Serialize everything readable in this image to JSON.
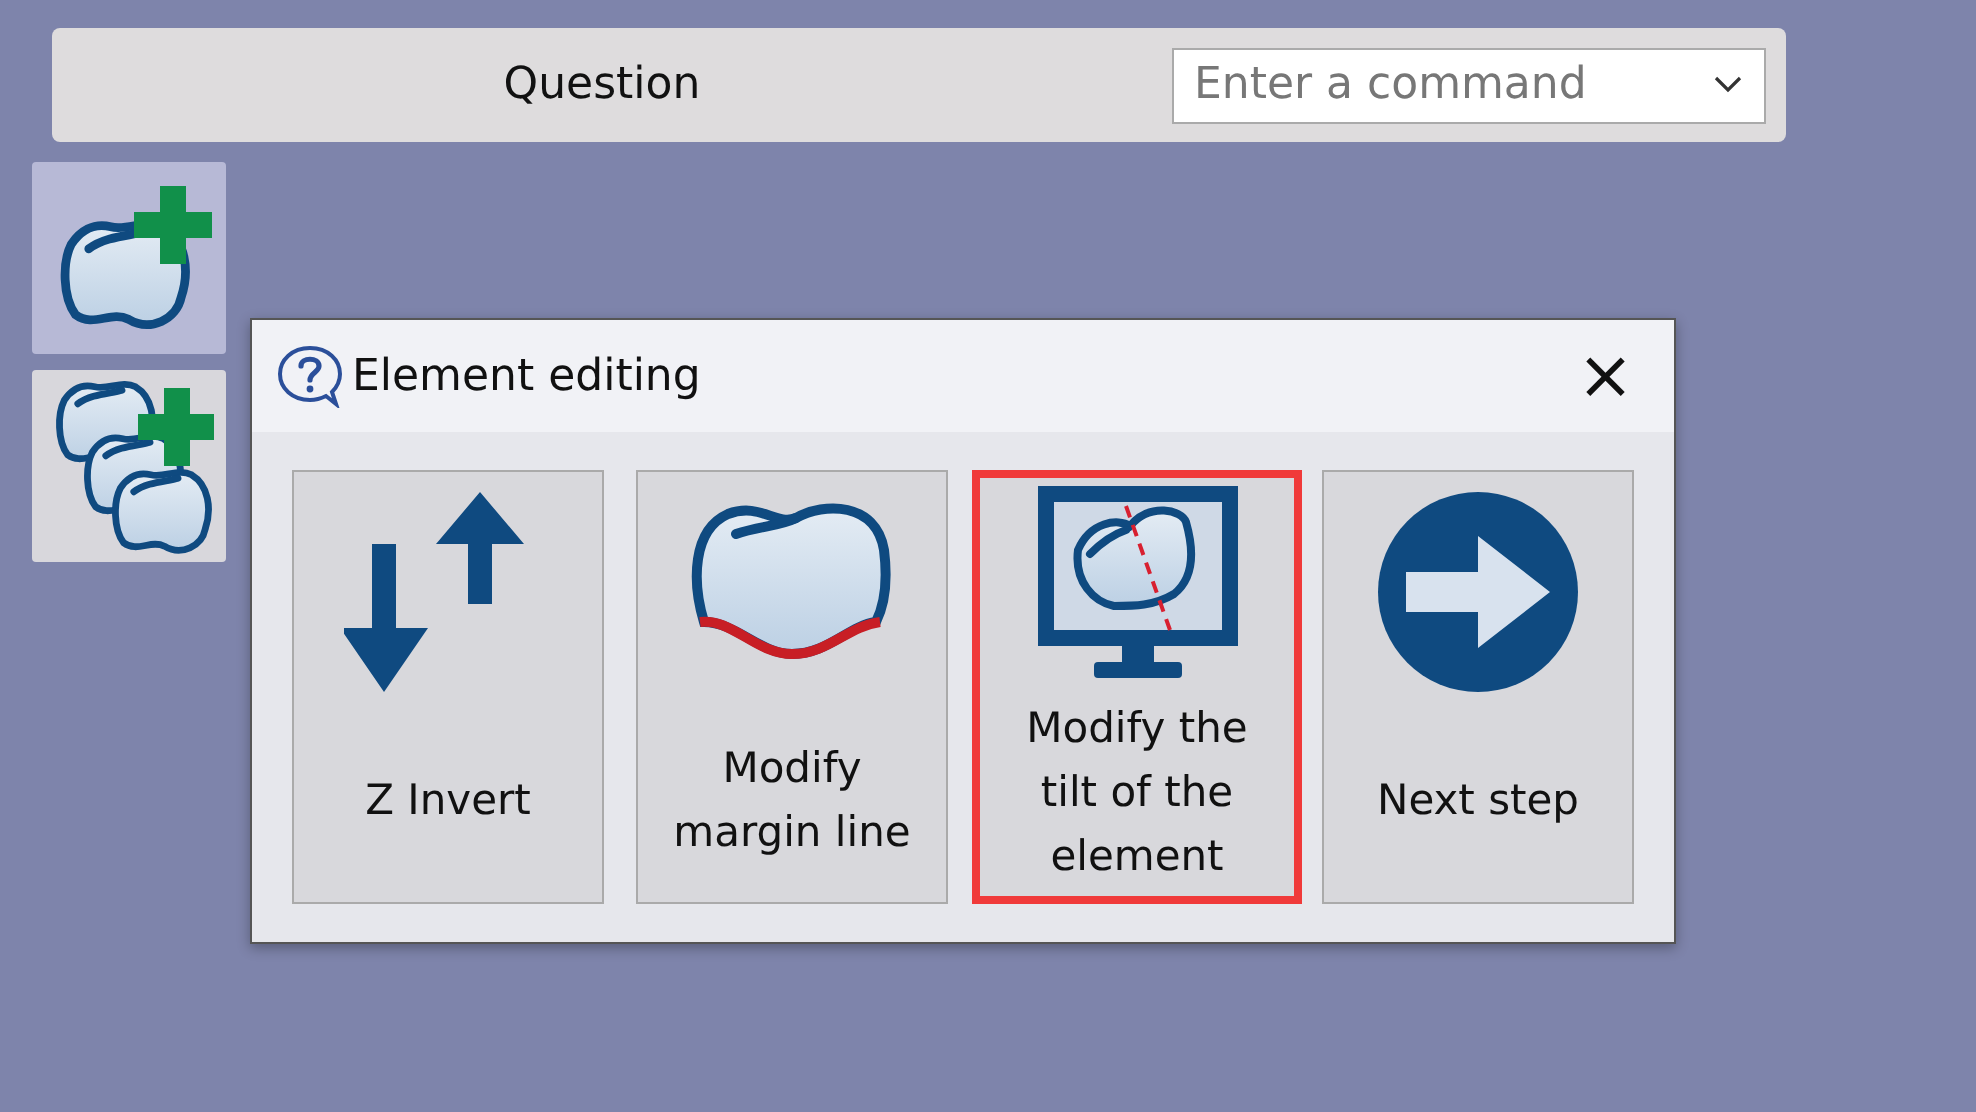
{
  "header": {
    "title": "Question",
    "command": {
      "placeholder": "Enter a command"
    }
  },
  "tools": [
    {
      "kind": "add-one",
      "selected": true
    },
    {
      "kind": "add-many",
      "selected": false
    }
  ],
  "dialog": {
    "title": "Element editing",
    "close": "×",
    "buttons": [
      {
        "kind": "z-invert",
        "label": "Z Invert",
        "highlighted": false
      },
      {
        "kind": "margin",
        "label": "Modify margin line",
        "highlighted": false
      },
      {
        "kind": "tilt",
        "label": "Modify the tilt of the element",
        "highlighted": true
      },
      {
        "kind": "next",
        "label": "Next step",
        "highlighted": false
      }
    ]
  }
}
